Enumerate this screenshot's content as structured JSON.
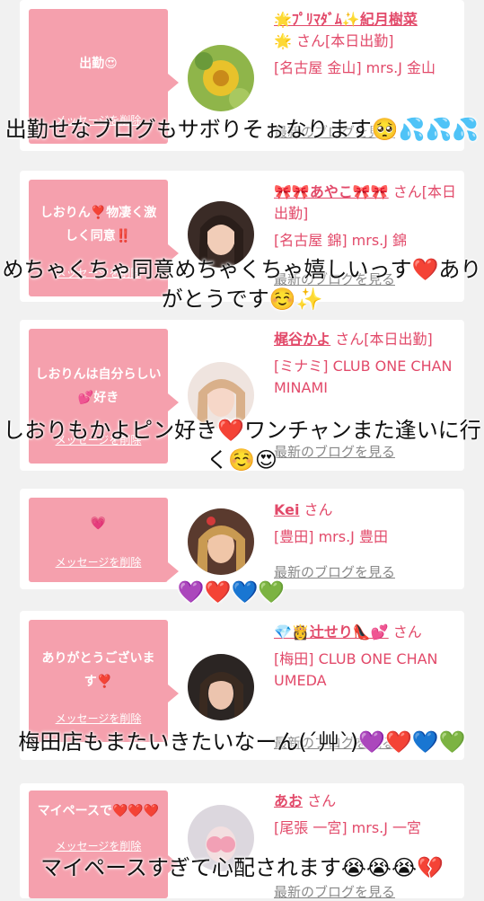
{
  "cards": [
    {
      "bubble": "出勤😍",
      "delete": "メッセージを削除",
      "name": "🌟ﾌﾟﾘﾏﾀﾞﾑ✨紀月樹菜",
      "name_suffix": "🌟 さん[本日出勤]",
      "location": "[名古屋 金山] mrs.J 金山",
      "blog_link": "最新のブログを見る"
    },
    {
      "bubble": "しおりん❣️物凄く激しく同意‼️",
      "delete": "メッセージを削除",
      "name": "🎀🎀あやこ🎀🎀",
      "name_suffix": "さん[本日出勤]",
      "location": "[名古屋 錦] mrs.J 錦",
      "blog_link": "最新のブログを見る"
    },
    {
      "bubble": "しおりんは自分らしい💕好き",
      "delete": "メッセージを削除",
      "name": "梶谷かよ",
      "name_suffix": "さん[本日出勤]",
      "location": "[ミナミ] CLUB ONE CHAN MINAMI",
      "blog_link": "最新のブログを見る"
    },
    {
      "bubble": "💗",
      "delete": "メッセージを削除",
      "name": "Kei",
      "name_suffix": "さん",
      "location": "[豊田] mrs.J 豊田",
      "blog_link": "最新のブログを見る"
    },
    {
      "bubble": "ありがとうございます❣️",
      "delete": "メッセージを削除",
      "name": "💎👸辻せり👠💕",
      "name_suffix": "さん",
      "location": "[梅田] CLUB ONE CHAN UMEDA",
      "blog_link": "最新のブログを見る"
    },
    {
      "bubble": "マイペースで❤️❤️❤️",
      "delete": "メッセージを削除",
      "name": "あお",
      "name_suffix": "さん",
      "location": "[尾張 一宮] mrs.J 一宮",
      "blog_link": "最新のブログを見る"
    }
  ],
  "captions": [
    "出勤せなブログもサボりそぉなります🥺💦💦💦",
    "めちゃくちゃ同意めちゃくちゃ嬉しいっす❤️ありがとうです☺️✨",
    "しおりもかよピン好き❤️ワンチャンまた逢いに行く☺️😍",
    "💜❤️💙💚",
    "梅田店もまたいきたいなーん(´艸`)💜❤️💙💚",
    "マイペースすぎて心配されます😭😭😭💔"
  ],
  "colors": {
    "accent": "#e24a6a",
    "bubble": "#f5a0ad",
    "background": "#f1f1f1"
  }
}
